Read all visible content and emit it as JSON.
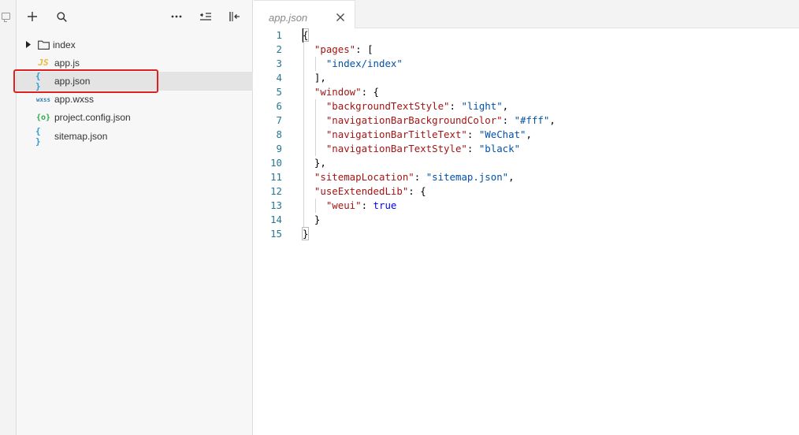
{
  "explorer": {
    "toolbar": {
      "add_icon": "plus-icon",
      "search_icon": "search-icon",
      "more_icon": "more-icon",
      "collapse_icon": "collapse-icon",
      "toggle_icon": "panel-toggle-icon"
    },
    "tree": [
      {
        "name": "index",
        "type": "folder",
        "icon": "folder-icon",
        "expanded": false
      },
      {
        "name": "app.js",
        "type": "file",
        "icon_text": "JS",
        "icon": "js-file-icon"
      },
      {
        "name": "app.json",
        "type": "file",
        "icon_text": "{ }",
        "icon": "json-file-icon",
        "selected": true
      },
      {
        "name": "app.wxss",
        "type": "file",
        "icon_text": "wxss",
        "icon": "wxss-file-icon"
      },
      {
        "name": "project.config.json",
        "type": "file",
        "icon_text": "{o}",
        "icon": "config-file-icon"
      },
      {
        "name": "sitemap.json",
        "type": "file",
        "icon_text": "{ }",
        "icon": "json-file-icon"
      }
    ]
  },
  "editor": {
    "tab": {
      "label": "app.json",
      "close_icon": "close-icon"
    },
    "lines": [
      {
        "n": "1",
        "text": "{"
      },
      {
        "n": "2",
        "text": "  \"pages\": ["
      },
      {
        "n": "3",
        "text": "    \"index/index\""
      },
      {
        "n": "4",
        "text": "  ],"
      },
      {
        "n": "5",
        "text": "  \"window\": {"
      },
      {
        "n": "6",
        "text": "    \"backgroundTextStyle\": \"light\","
      },
      {
        "n": "7",
        "text": "    \"navigationBarBackgroundColor\": \"#fff\","
      },
      {
        "n": "8",
        "text": "    \"navigationBarTitleText\": \"WeChat\","
      },
      {
        "n": "9",
        "text": "    \"navigationBarTextStyle\": \"black\""
      },
      {
        "n": "10",
        "text": "  },"
      },
      {
        "n": "11",
        "text": "  \"sitemapLocation\": \"sitemap.json\","
      },
      {
        "n": "12",
        "text": "  \"useExtendedLib\": {"
      },
      {
        "n": "13",
        "text": "    \"weui\": true"
      },
      {
        "n": "14",
        "text": "  }"
      },
      {
        "n": "15",
        "text": "}"
      }
    ]
  },
  "colors": {
    "key": "#a31515",
    "string": "#0451a5",
    "boolean": "#0000ff",
    "line_number": "#237893",
    "highlight_border": "#e02020"
  }
}
